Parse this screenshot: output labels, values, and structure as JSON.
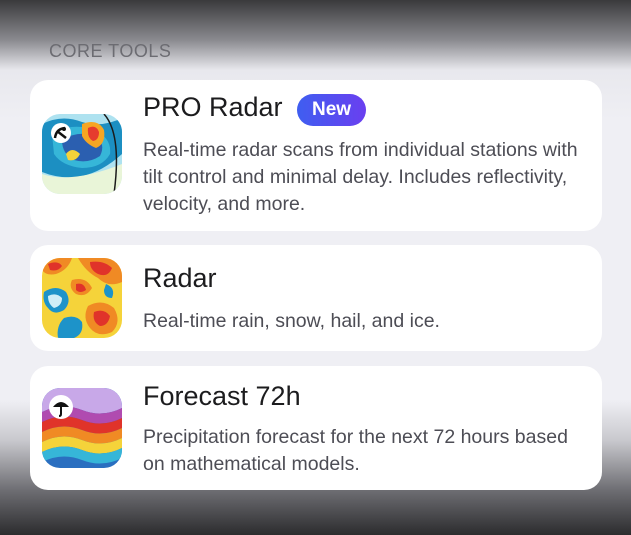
{
  "section": {
    "header": "CORE TOOLS"
  },
  "items": [
    {
      "title": "PRO Radar",
      "badge": "New",
      "description": "Real-time radar scans from individual stations with tilt control and minimal delay. Includes reflectivity, velocity, and more.",
      "icon": "pro-radar-map-icon"
    },
    {
      "title": "Radar",
      "description": "Real-time rain, snow, hail, and ice.",
      "icon": "radar-heatmap-icon"
    },
    {
      "title": "Forecast 72h",
      "description": "Precipitation forecast for the next 72 hours based on mathematical models.",
      "icon": "forecast-umbrella-icon"
    }
  ],
  "colors": {
    "badge_gradient_start": "#3f5ef0",
    "badge_gradient_end": "#6a3ff0",
    "card_background": "#ffffff",
    "page_background": "#efeff4"
  }
}
